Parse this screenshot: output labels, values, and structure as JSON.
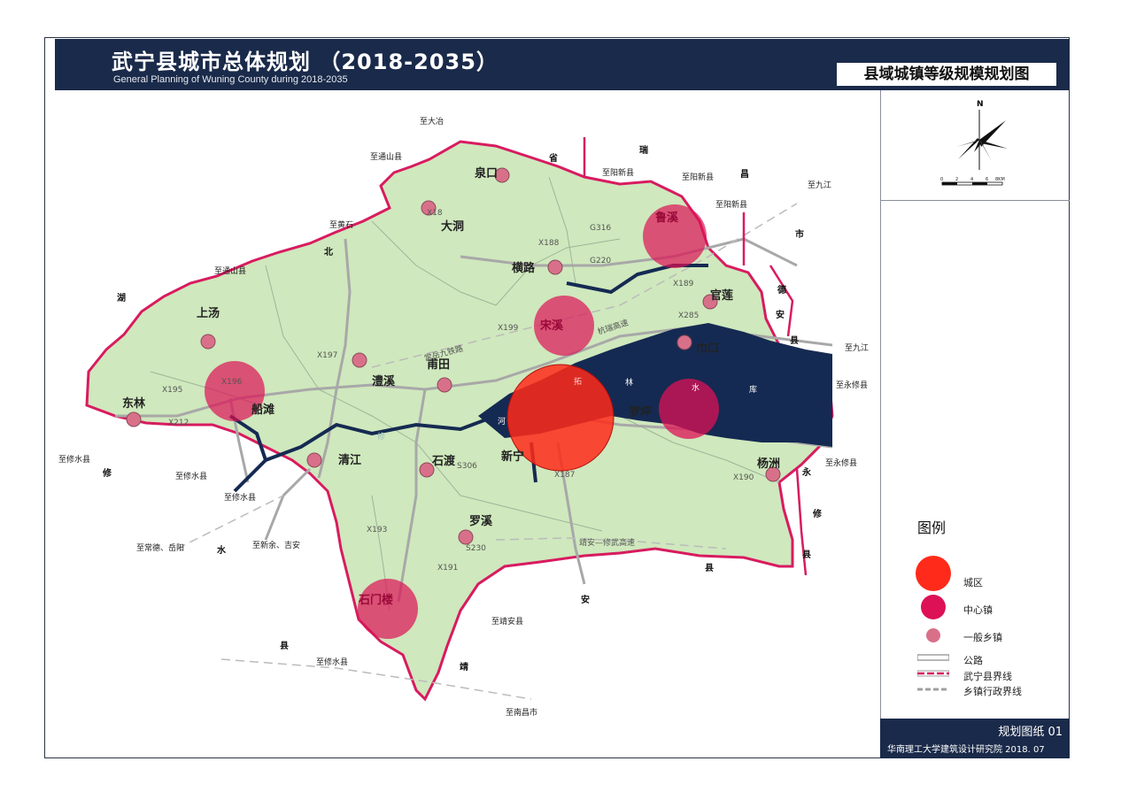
{
  "header": {
    "title": "武宁县城市总体规划 （2018-2035）",
    "subtitle": "General Planning  of Wuning County during 2018-2035",
    "map_title": "县域城镇等级规模规划图"
  },
  "compass": {
    "north_label": "N"
  },
  "scale_bar": {
    "ticks": [
      "0",
      "2",
      "4",
      "6",
      "8KM"
    ]
  },
  "legend": {
    "title": "图例",
    "items": [
      {
        "label": "城区",
        "color": "#ff2a1a"
      },
      {
        "label": "中心镇",
        "color": "#dd1155"
      },
      {
        "label": "一般乡镇",
        "color": "#d9708a"
      },
      {
        "label": "公路",
        "color": "#9a9a9a"
      },
      {
        "label": "武宁县界线",
        "color": "#d81b60"
      },
      {
        "label": "乡镇行政界线",
        "color": "#a0a0a0"
      }
    ]
  },
  "footer": {
    "sheet": "规划图纸 01",
    "institute": "华南理工大学建筑设计研究院  2018. 07"
  },
  "colors": {
    "header_bg": "#1a2a4a",
    "land": "#cfe8bd",
    "water": "#152a52",
    "border": "#d81b60"
  },
  "towns": {
    "city": {
      "name": "新宁"
    },
    "centers": [
      {
        "name": "鲁溪"
      },
      {
        "name": "宋溪"
      },
      {
        "name": "罗坪"
      },
      {
        "name": "船滩"
      },
      {
        "name": "石门楼"
      }
    ],
    "ordinary": [
      {
        "name": "泉口"
      },
      {
        "name": "大洞"
      },
      {
        "name": "横路"
      },
      {
        "name": "官莲"
      },
      {
        "name": "巾口"
      },
      {
        "name": "甫田"
      },
      {
        "name": "澧溪"
      },
      {
        "name": "上汤"
      },
      {
        "name": "东林"
      },
      {
        "name": "清江"
      },
      {
        "name": "石渡"
      },
      {
        "name": "罗溪"
      },
      {
        "name": "杨洲"
      }
    ]
  },
  "road_labels": [
    "G316",
    "G220",
    "X188",
    "X189",
    "X285",
    "X199",
    "X197",
    "X195",
    "X212",
    "X196",
    "X18",
    "S306",
    "X187",
    "X190",
    "X193",
    "X191",
    "S230",
    "常岳九铁路",
    "杭瑞高速",
    "靖安—修武高速"
  ],
  "destinations": [
    "至大冶",
    "至通山县",
    "至黄石",
    "至通山县",
    "至阳新县",
    "至阳新县",
    "至阳新县",
    "至九江",
    "至九江",
    "至永修县",
    "至永修县",
    "至修水县",
    "至修水县",
    "至修水县",
    "至常德、岳阳",
    "至新余、吉安",
    "至靖安县",
    "至修水县",
    "至南昌市"
  ],
  "region_labels": [
    "省",
    "瑞",
    "昌",
    "市",
    "德",
    "安",
    "县",
    "湖",
    "北",
    "修",
    "水",
    "永",
    "修",
    "县",
    "安",
    "县",
    "靖",
    "县"
  ],
  "lake_labels": [
    "拓",
    "林",
    "水",
    "库",
    "河",
    "修"
  ]
}
